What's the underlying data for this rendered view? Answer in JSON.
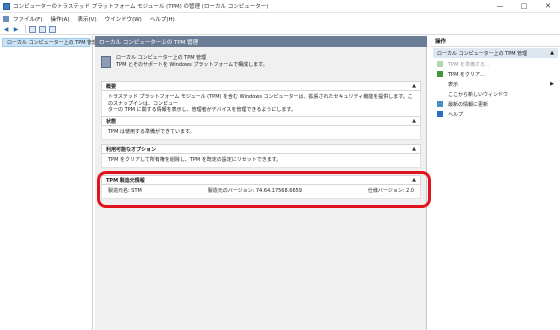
{
  "window": {
    "title": "コンピューターのトラステッド プラットフォーム モジュール (TPM) の管理 (ローカル コンピューター)",
    "minimize": "—",
    "maximize": "□",
    "close": "✕"
  },
  "menu": [
    "ファイル(F)",
    "操作(A)",
    "表示(V)",
    "ウインドウ(W)",
    "ヘルプ(H)"
  ],
  "toolbar": {
    "back": "◀",
    "forward": "▶"
  },
  "tree": {
    "root": "ローカル コンピューター上の TPM 管理"
  },
  "center": {
    "header": "ローカル コンピューター上の TPM 管理",
    "intro": {
      "line1": "ローカル コンピューター上の TPM 管理",
      "line2": "TPM とそのサポートを Windows プラットフォームで構成します。"
    },
    "sections": {
      "overview": {
        "title": "概要",
        "text1": "トラステッド プラットフォーム モジュール (TPM) を含む Windows コンピューターは、拡張されたセキュリティ機能を提供します。このスナップインは、コンピュー",
        "text2": "ターの TPM に関する情報を表示し、管理者がデバイスを管理できるようにします。"
      },
      "status": {
        "title": "状態",
        "text": "TPM は使用する準備ができています。"
      },
      "options": {
        "title": "利用可能なオプション",
        "text": "TPM をクリアして所有権を削除し、TPM を既定の設定にリセットできます。"
      },
      "maker": {
        "title": "TPM 製造元情報",
        "manufacturer": "製造元名: STM",
        "version": "製造元のバージョン: 74.64.17568.6659",
        "spec": "仕様バージョン: 2.0"
      }
    },
    "collapse_arrow": "▲"
  },
  "actions": {
    "title": "操作",
    "subheader": "ローカル コンピューター上の TPM 管理",
    "subheader_arrow": "▲",
    "items": [
      {
        "label": "TPM を準備する...",
        "disabled": true
      },
      {
        "label": "TPM をクリア...",
        "disabled": false
      },
      {
        "label": "表示",
        "disabled": false
      },
      {
        "label": "ここから新しいウィンドウ",
        "disabled": false
      },
      {
        "label": "最新の情報に更新",
        "disabled": false
      },
      {
        "label": "ヘルプ",
        "disabled": false
      }
    ],
    "view_arrow": "▶"
  },
  "colors": {
    "highlight": "#e0141e",
    "header_bg": "#6b7c95",
    "tree_selected": "#cce4f7"
  }
}
